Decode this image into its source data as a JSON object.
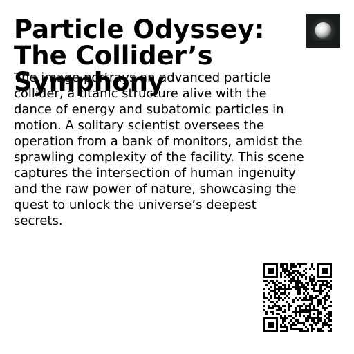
{
  "card": {
    "title": "Particle Odyssey: The Collider’s Symphony",
    "description": "The image portrays an advanced particle collider, a titanic structure alive with the dance of energy and subatomic particles in motion. A solitary scientist oversees the operation from a bank of monitors, amidst the sprawling complexity of the facility. This scene captures the intersection of human ingenuity and the raw power of nature, showcasing the quest to unlock the universe’s deepest secrets."
  },
  "icons": {
    "thumbnail": "glowing-sphere-thumbnail",
    "qr": "qr-code"
  },
  "colors": {
    "text": "#000000",
    "background": "#ffffff",
    "thumbnail_background": "#1a1c1c"
  }
}
